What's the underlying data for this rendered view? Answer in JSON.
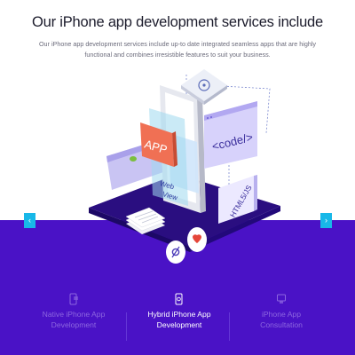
{
  "section": {
    "heading": "Our iPhone app development services include",
    "subtext": "Our iPhone app development services include up-to date integrated seamless apps that are highly functional and combines irresistible features to suit your business."
  },
  "illustration": {
    "app_label": "APP",
    "code_label": "<code/>",
    "html_label": "HTML5/JS",
    "web_label": "Web",
    "view_label": "View"
  },
  "carousel": {
    "prev_icon": "chevron-left-icon",
    "next_icon": "chevron-right-icon",
    "prev_glyph": "‹",
    "next_glyph": "›"
  },
  "services": [
    {
      "label_line1": "Native iPhone App",
      "label_line2": "Development",
      "icon": "phone-icon",
      "active": false
    },
    {
      "label_line1": "Hybrid iPhone App",
      "label_line2": "Development",
      "icon": "phone-gear-icon",
      "active": true
    },
    {
      "label_line1": "iPhone App",
      "label_line2": "Consultation",
      "icon": "consult-icon",
      "active": false
    }
  ],
  "colors": {
    "accent": "#18b8e8",
    "band": "#4a12c6",
    "app_card": "#f07054",
    "active_text": "#ffffff",
    "inactive_text": "#8d67e0"
  }
}
